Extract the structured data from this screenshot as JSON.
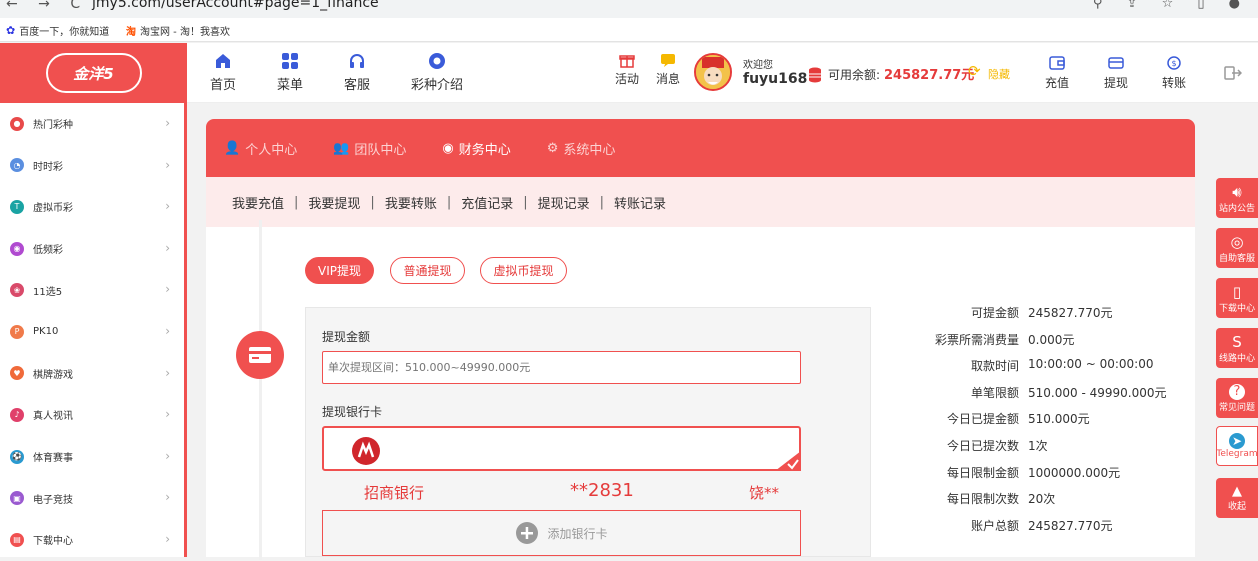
{
  "browser": {
    "url": "jmy5.com/userAccount#page=1_finance"
  },
  "bookmarks": [
    {
      "label": "百度一下，你就知道"
    },
    {
      "label": "淘宝网 - 淘！我喜欢"
    }
  ],
  "logo": {
    "text": "金洋5"
  },
  "topnav": [
    {
      "label": "首页",
      "icon": "home-icon"
    },
    {
      "label": "菜单",
      "icon": "menu-grid-icon"
    },
    {
      "label": "客服",
      "icon": "headset-icon"
    },
    {
      "label": "彩种介绍",
      "icon": "lottery-icon"
    }
  ],
  "header": {
    "activity": "活动",
    "messages": "消息",
    "welcome": "欢迎您",
    "username": "fuyu168",
    "balance_label": "可用余额:",
    "balance_value": "245827.77元",
    "hide": "隐藏",
    "deposit": "充值",
    "withdraw": "提现",
    "transfer": "转账"
  },
  "sidebar": {
    "items": [
      {
        "label": "热门彩种",
        "color": "#e84a4a"
      },
      {
        "label": "时时彩",
        "color": "#5b8fe0"
      },
      {
        "label": "虚拟币彩",
        "color": "#1aa3a3"
      },
      {
        "label": "低频彩",
        "color": "#b04ad0"
      },
      {
        "label": "11选5",
        "color": "#d94a6a"
      },
      {
        "label": "PK10",
        "color": "#f07a4a"
      },
      {
        "label": "棋牌游戏",
        "color": "#f06a3a"
      },
      {
        "label": "真人视讯",
        "color": "#e0406a"
      },
      {
        "label": "体育赛事",
        "color": "#2a9ad0"
      },
      {
        "label": "电子竞技",
        "color": "#9a5ad0"
      },
      {
        "label": "下载中心",
        "color": "#f05050"
      }
    ]
  },
  "tabs": [
    {
      "label": "个人中心",
      "icon": "user-icon"
    },
    {
      "label": "团队中心",
      "icon": "team-icon"
    },
    {
      "label": "财务中心",
      "icon": "finance-icon",
      "active": true
    },
    {
      "label": "系统中心",
      "icon": "gear-icon"
    }
  ],
  "subtabs": [
    "我要充值",
    "我要提现",
    "我要转账",
    "充值记录",
    "提现记录",
    "转账记录"
  ],
  "withdraw_types": [
    {
      "label": "VIP提现",
      "active": true
    },
    {
      "label": "普通提现",
      "active": false
    },
    {
      "label": "虚拟币提现",
      "active": false
    }
  ],
  "form": {
    "amount_label": "提现金额",
    "amount_placeholder": "单次提现区间：510.000~49990.000元",
    "card_label": "提现银行卡",
    "bank_name": "招商银行",
    "card_number": "**2831",
    "holder": "饶**",
    "add_card": "添加银行卡"
  },
  "info": [
    {
      "k": "可提金额",
      "v": "245827.770元"
    },
    {
      "k": "彩票所需消费量",
      "v": "0.000元"
    },
    {
      "k": "取款时间",
      "v": "10:00:00 ~ 00:00:00"
    },
    {
      "k": "单笔限额",
      "v": "510.000 - 49990.000元"
    },
    {
      "k": "今日已提金额",
      "v": "510.000元"
    },
    {
      "k": "今日已提次数",
      "v": "1次"
    },
    {
      "k": "每日限制金额",
      "v": "1000000.000元"
    },
    {
      "k": "每日限制次数",
      "v": "20次"
    },
    {
      "k": "账户总额",
      "v": "245827.770元"
    }
  ],
  "rightbar": [
    {
      "label": "站内公告",
      "icon": "speaker-icon"
    },
    {
      "label": "自助客服",
      "icon": "support-icon"
    },
    {
      "label": "下载中心",
      "icon": "phone-icon"
    },
    {
      "label": "线路中心",
      "icon": "route-icon"
    },
    {
      "label": "常见问题",
      "icon": "question-icon"
    },
    {
      "label": "Telegram",
      "icon": "telegram-icon"
    },
    {
      "label": "收起",
      "icon": "collapse-icon"
    }
  ],
  "colors": {
    "brand": "#f0504f",
    "accent_text": "#e53b3b"
  }
}
